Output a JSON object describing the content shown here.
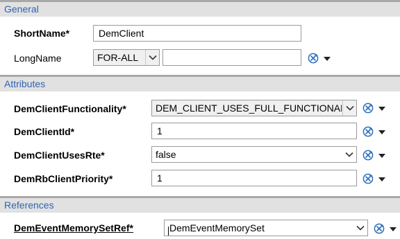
{
  "sections": {
    "general": "General",
    "attributes": "Attributes",
    "references": "References"
  },
  "general": {
    "shortname_label": "ShortName*",
    "shortname_value": "DemClient",
    "longname_label": "LongName",
    "longname_lang": "FOR-ALL",
    "longname_value": ""
  },
  "attributes": {
    "functionality_label": "DemClientFunctionality*",
    "functionality_value": "DEM_CLIENT_USES_FULL_FUNCTIONALIT",
    "clientid_label": "DemClientId*",
    "clientid_value": "1",
    "usesrte_label": "DemClientUsesRte*",
    "usesrte_value": "false",
    "priority_label": "DemRbClientPriority*",
    "priority_value": "1"
  },
  "references": {
    "memoryset_label": "DemEventMemorySetRef*",
    "memoryset_value": "DemEventMemorySet"
  },
  "colors": {
    "section_text": "#2f63b0",
    "section_bg": "#e1e1e1",
    "icon_blue": "#2a6fb8"
  },
  "icons": [
    "reset-icon",
    "menu-dropdown-icon",
    "chevron-down-icon"
  ]
}
